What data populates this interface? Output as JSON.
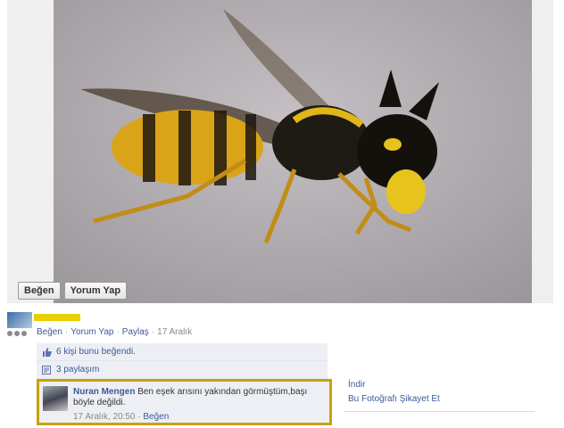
{
  "photo_actions": {
    "like": "Beğen",
    "comment": "Yorum Yap"
  },
  "action_bar": {
    "like": "Beğen",
    "comment": "Yorum Yap",
    "share": "Paylaş",
    "date": "17 Aralık"
  },
  "ufi": {
    "likes_text": "6 kişi bunu beğendi.",
    "shares_text": "3 paylaşım"
  },
  "comment": {
    "author": "Nuran Mengen",
    "text": "Ben eşek arısını yakından görmüştüm,başı böyle değildi.",
    "time": "17 Aralık, 20:50",
    "like": "Beğen"
  },
  "right_column": {
    "download": "İndir",
    "report": "Bu Fotoğrafı Şikayet Et"
  },
  "colors": {
    "link": "#3b5998",
    "highlight": "#c8a200",
    "ufi_bg": "#edeff4"
  }
}
